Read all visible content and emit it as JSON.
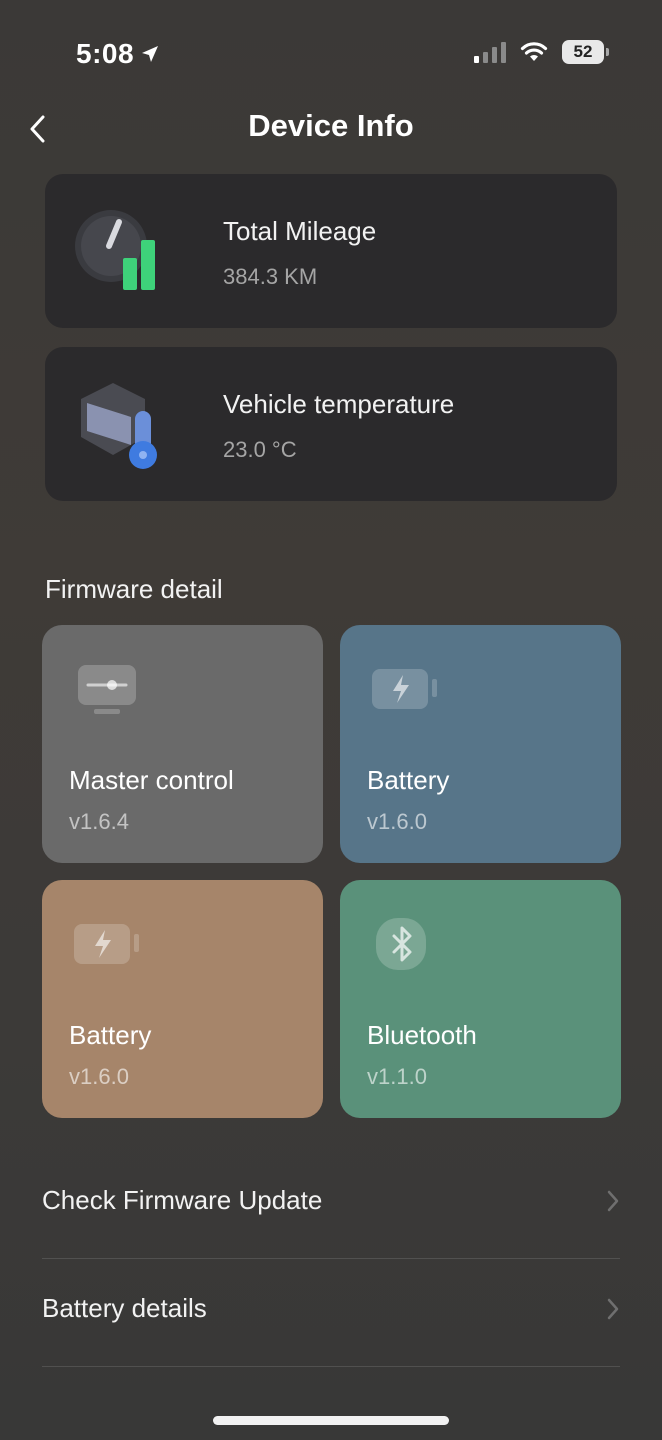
{
  "status_bar": {
    "time": "5:08",
    "battery": "52"
  },
  "nav": {
    "title": "Device Info"
  },
  "info_cards": [
    {
      "title": "Total Mileage",
      "value": "384.3 KM",
      "icon": "speedometer-icon"
    },
    {
      "title": "Vehicle temperature",
      "value": "23.0 °C",
      "icon": "thermometer-icon"
    }
  ],
  "firmware": {
    "section_title": "Firmware detail",
    "items": [
      {
        "name": "Master control",
        "version": "v1.6.4",
        "icon": "controller-icon",
        "color": "#6a6a6a"
      },
      {
        "name": "Battery",
        "version": "v1.6.0",
        "icon": "battery-icon",
        "color": "#577589"
      },
      {
        "name": "Battery",
        "version": "v1.6.0",
        "icon": "battery-icon",
        "color": "#a6856a"
      },
      {
        "name": "Bluetooth",
        "version": "v1.1.0",
        "icon": "bluetooth-icon",
        "color": "#5a917a"
      }
    ]
  },
  "list": [
    {
      "label": "Check Firmware Update"
    },
    {
      "label": "Battery details"
    }
  ]
}
